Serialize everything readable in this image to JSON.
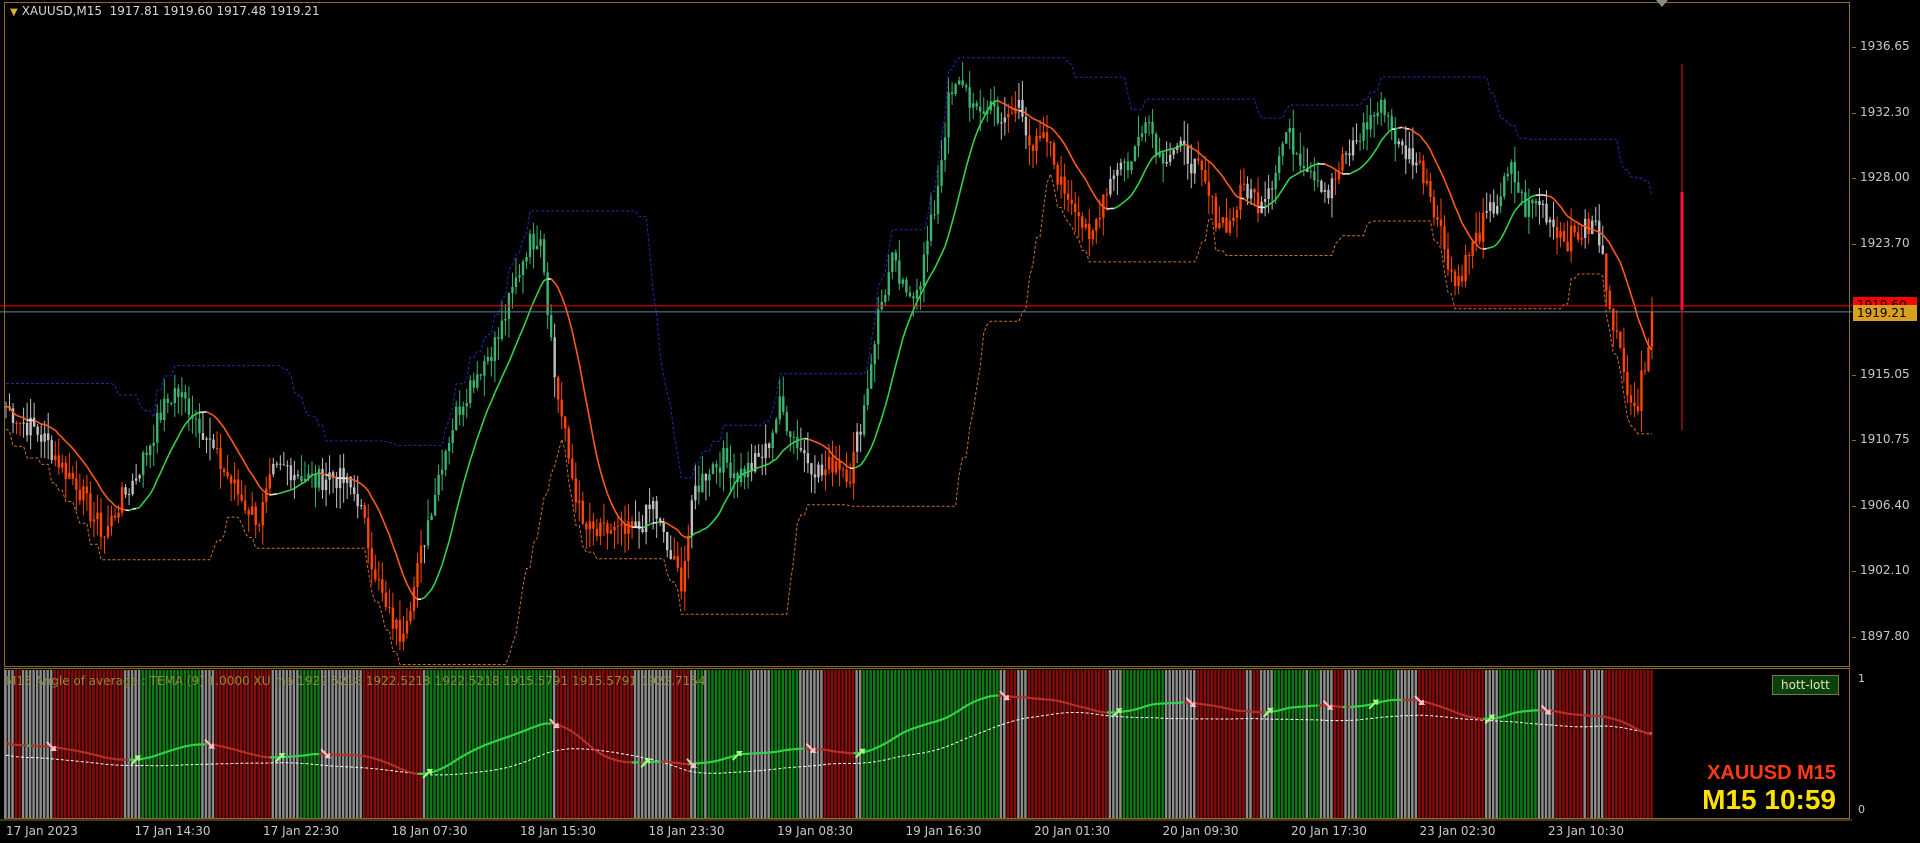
{
  "chart_header": {
    "symbol_timeframe": "XAUUSD,M15",
    "ohlc": "1917.81 1919.60 1917.48 1919.21"
  },
  "price_axis": {
    "labels": [
      "1936.65",
      "1932.30",
      "1928.00",
      "1923.70",
      "1919.21",
      "1915.05",
      "1910.75",
      "1906.40",
      "1902.10",
      "1897.80"
    ],
    "current_price": "1919.21",
    "ask_price": "1919.60"
  },
  "time_axis": {
    "labels": [
      "17 Jan 2023",
      "17 Jan 14:30",
      "17 Jan 22:30",
      "18 Jan 07:30",
      "18 Jan 15:30",
      "18 Jan 23:30",
      "19 Jan 08:30",
      "19 Jan 16:30",
      "20 Jan 01:30",
      "20 Jan 09:30",
      "20 Jan 17:30",
      "23 Jan 02:30",
      "23 Jan 10:30"
    ]
  },
  "indicator": {
    "caption": "M15  Angle of average :  TEMA (9)  1.0000  XU ma  1922.5218 1922.5218 1922.5218 1915.5791 1915.5791 1922.7154",
    "button_label": "hott-lott",
    "scale_top": "1",
    "scale_bottom": "0"
  },
  "overlay": {
    "symbol_label": "XAUUSD M15",
    "countdown": "M15 10:59"
  },
  "colors": {
    "bull_candle": "#3cb371",
    "bear_candle": "#ff4500",
    "neutral_candle": "#c0c0c0",
    "bid_line": "#708090",
    "ask_line": "#ff0000",
    "frame": "#8a6d2a"
  },
  "chart_data": {
    "type": "candlestick",
    "title": "XAUUSD,M15",
    "ylim": [
      1896.0,
      1939.5
    ],
    "y_ticks": [
      1936.65,
      1932.3,
      1928.0,
      1923.7,
      1919.21,
      1915.05,
      1910.75,
      1906.4,
      1902.1,
      1897.8
    ],
    "x_labels": [
      "17 Jan 2023",
      "17 Jan 14:30",
      "17 Jan 22:30",
      "18 Jan 07:30",
      "18 Jan 15:30",
      "18 Jan 23:30",
      "19 Jan 08:30",
      "19 Jan 16:30",
      "20 Jan 01:30",
      "20 Jan 09:30",
      "20 Jan 17:30",
      "23 Jan 02:30",
      "23 Jan 10:30"
    ],
    "close_path": [
      1913.0,
      1912.0,
      1911.5,
      1910.5,
      1909.0,
      1908.0,
      1906.0,
      1904.5,
      1906.5,
      1908.0,
      1910.0,
      1912.5,
      1914.0,
      1913.0,
      1911.5,
      1909.5,
      1908.0,
      1906.5,
      1905.5,
      1908.5,
      1909.0,
      1908.5,
      1908.0,
      1908.5,
      1908.0,
      1907.0,
      1903.0,
      1899.5,
      1898.0,
      1901.0,
      1905.5,
      1909.5,
      1912.5,
      1914.5,
      1916.0,
      1917.5,
      1920.5,
      1923.5,
      1924.5,
      1915.0,
      1909.5,
      1905.0,
      1904.5,
      1904.8,
      1904.5,
      1905.0,
      1906.5,
      1903.5,
      1901.5,
      1907.5,
      1909.0,
      1909.5,
      1908.5,
      1909.0,
      1910.0,
      1913.0,
      1911.0,
      1909.5,
      1908.5,
      1909.5,
      1908.5,
      1913.0,
      1919.0,
      1922.5,
      1920.0,
      1921.5,
      1926.0,
      1933.0,
      1934.5,
      1932.0,
      1933.0,
      1931.5,
      1933.0,
      1930.0,
      1930.5,
      1927.5,
      1926.5,
      1923.5,
      1927.0,
      1929.0,
      1929.0,
      1932.5,
      1929.5,
      1930.0,
      1929.5,
      1928.0,
      1925.5,
      1925.0,
      1927.5,
      1926.5,
      1928.0,
      1931.0,
      1929.5,
      1928.5,
      1927.0,
      1929.0,
      1930.5,
      1932.0,
      1932.8,
      1930.0,
      1929.5,
      1928.0,
      1924.5,
      1921.0,
      1923.0,
      1925.0,
      1926.5,
      1928.5,
      1926.0,
      1926.5,
      1925.0,
      1924.0,
      1924.5,
      1925.0,
      1920.0,
      1915.0,
      1913.0,
      1919.21
    ],
    "bid": 1919.21,
    "ask": 1919.6
  }
}
